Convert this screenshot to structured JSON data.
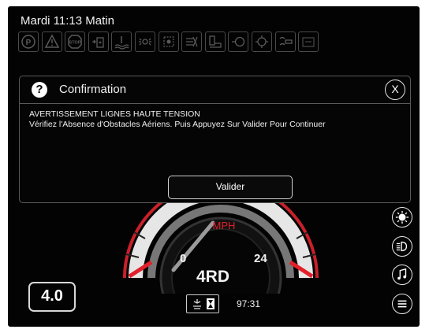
{
  "status_bar": {
    "datetime": "Mardi 11:13 Matin"
  },
  "tell_tales": [
    "parking-brake-icon",
    "warning-icon",
    "stop-icon",
    "fuel-level-icon",
    "coolant-temp-icon",
    "transmission-icon",
    "hydraulic-icon",
    "no-filter-icon",
    "hydraulic-oil-icon",
    "engine-icon",
    "air-filter-icon",
    "glow-plug-icon",
    "battery-icon"
  ],
  "dialog": {
    "title": "Confirmation",
    "close_label": "X",
    "message_line1": "AVERTISSEMENT LIGNES HAUTE TENSION",
    "message_line2": "Vérifiez l'Absence d'Obstacles Aériens. Puis Appuyez Sur Valider Pour Continuer",
    "button_label": "Valider"
  },
  "gauge": {
    "unit": "MPH",
    "min_label": "0",
    "max_label": "24"
  },
  "drive_mode": "4RD",
  "version": "4.0",
  "timer": {
    "value": "97:31"
  },
  "side_buttons": [
    "brightness-icon",
    "lights-icon",
    "music-icon",
    "menu-icon"
  ]
}
